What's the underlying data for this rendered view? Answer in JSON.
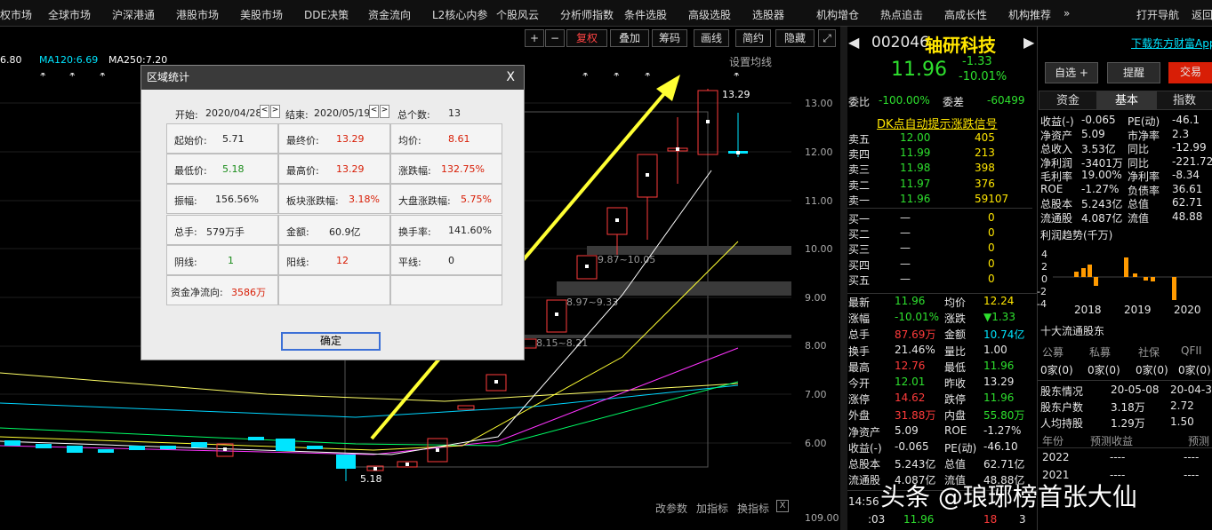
{
  "nav": [
    "权市场",
    "全球市场",
    "沪深港通",
    "港股市场",
    "美股市场",
    "DDE决策",
    "资金流向",
    "L2核心内参",
    "个股风云",
    "分析师指数",
    "条件选股",
    "高级选股",
    "选股器",
    "机构增仓",
    "热点追击",
    "高成长性",
    "机构推荐",
    "»",
    "打开导航",
    "返回"
  ],
  "toolbar": {
    "plus": "+",
    "minus": "−",
    "fuquan": "复权",
    "diejia": "叠加",
    "chouma": "筹码",
    "huaxian": "画线",
    "jianyue": "简约",
    "yincang": "隐藏"
  },
  "ma_labels": {
    "ma_a": "6.80",
    "ma120": "MA120:6.69",
    "ma250": "MA250:7.20",
    "setting": "设置均线"
  },
  "price_axis": [
    "13.00",
    "12.00",
    "11.00",
    "10.00",
    "9.00",
    "8.00",
    "7.00",
    "6.00",
    "109.00"
  ],
  "chart_annotations": {
    "high": "13.29",
    "low": "5.18",
    "gap1": "9.87~10.05",
    "gap2": "8.97~9.33",
    "gap3": "8.15~8.21"
  },
  "bottom_bar": {
    "gaicanshu": "改参数",
    "jiazhibiao": "加指标",
    "huanzhibiao": "换指标",
    "close": "X"
  },
  "dialog": {
    "title": "区域统计",
    "close": "X",
    "start_label": "开始:",
    "start": "2020/04/28",
    "end_label": "结束:",
    "end": "2020/05/19",
    "count_label": "总个数:",
    "count": "13",
    "qishi_label": "起始价:",
    "qishi": "5.71",
    "zuizhong_label": "最终价:",
    "zuizhong": "13.29",
    "junjia_label": "均价:",
    "junjia": "8.61",
    "zuidi_label": "最低价:",
    "zuidi": "5.18",
    "zuigao_label": "最高价:",
    "zuigao": "13.29",
    "zhangdie_label": "涨跌幅:",
    "zhangdie": "132.75%",
    "zhenfu_label": "振幅:",
    "zhenfu": "156.56%",
    "bankuai_label": "板块涨跌幅:",
    "bankuai": "3.18%",
    "dapan_label": "大盘涨跌幅:",
    "dapan": "5.75%",
    "zongshou_label": "总手:",
    "zongshou": "579万手",
    "jine_label": "金额:",
    "jine": "60.9亿",
    "huanshou_label": "换手率:",
    "huanshou": "141.60%",
    "yinxian_label": "阴线:",
    "yinxian": "1",
    "yangxian_label": "阳线:",
    "yangxian": "12",
    "pingxian_label": "平线:",
    "pingxian": "0",
    "zijin_label": "资金净流向:",
    "zijin": "3586万",
    "ok": "确定"
  },
  "stock": {
    "code": "002046",
    "name": "轴研科技",
    "price": "11.96",
    "change": "-1.33",
    "pct": "-10.01%",
    "download": "下载东方财富App",
    "zixuan": "自选 +",
    "tixing": "提醒",
    "jiaoyi": "交易"
  },
  "weibi": {
    "label1": "委比",
    "v1": "-100.00%",
    "label2": "委差",
    "v2": "-60499"
  },
  "signal": "DK点自动提示涨跌信号",
  "orders": [
    {
      "l": "卖五",
      "p": "12.00",
      "v": "405"
    },
    {
      "l": "卖四",
      "p": "11.99",
      "v": "213"
    },
    {
      "l": "卖三",
      "p": "11.98",
      "v": "398"
    },
    {
      "l": "卖二",
      "p": "11.97",
      "v": "376"
    },
    {
      "l": "卖一",
      "p": "11.96",
      "v": "59107"
    },
    {
      "l": "买一",
      "p": "—",
      "v": "0"
    },
    {
      "l": "买二",
      "p": "—",
      "v": "0"
    },
    {
      "l": "买三",
      "p": "—",
      "v": "0"
    },
    {
      "l": "买四",
      "p": "—",
      "v": "0"
    },
    {
      "l": "买五",
      "p": "—",
      "v": "0"
    }
  ],
  "quote": [
    {
      "k1": "最新",
      "v1": "11.96",
      "k2": "均价",
      "v2": "12.24"
    },
    {
      "k1": "涨幅",
      "v1": "-10.01%",
      "k2": "涨跌",
      "v2": "▼1.33"
    },
    {
      "k1": "总手",
      "v1": "87.69万",
      "k2": "金额",
      "v2": "10.74亿"
    },
    {
      "k1": "换手",
      "v1": "21.46%",
      "k2": "量比",
      "v2": "1.00"
    },
    {
      "k1": "最高",
      "v1": "12.76",
      "k2": "最低",
      "v2": "11.96"
    },
    {
      "k1": "今开",
      "v1": "12.01",
      "k2": "昨收",
      "v2": "13.29"
    },
    {
      "k1": "涨停",
      "v1": "14.62",
      "k2": "跌停",
      "v2": "11.96"
    },
    {
      "k1": "外盘",
      "v1": "31.88万",
      "k2": "内盘",
      "v2": "55.80万"
    },
    {
      "k1": "净资产",
      "v1": "5.09",
      "k2": "ROE",
      "v2": "-1.27%"
    },
    {
      "k1": "收益(-)",
      "v1": "-0.065",
      "k2": "PE(动)",
      "v2": "-46.10"
    },
    {
      "k1": "总股本",
      "v1": "5.243亿",
      "k2": "总值",
      "v2": "62.71亿"
    },
    {
      "k1": "流通股",
      "v1": "4.087亿",
      "k2": "流值",
      "v2": "48.88亿"
    }
  ],
  "tick": {
    "time": "14:56",
    "sec": ":03",
    "price": "11.96",
    "vol": "18",
    "n": "3"
  },
  "tabs": [
    "资金",
    "基本",
    "指数"
  ],
  "fund": [
    {
      "k1": "收益(-)",
      "v1": "-0.065",
      "k2": "PE(动)",
      "v2": "-46.1"
    },
    {
      "k1": "净资产",
      "v1": "5.09",
      "k2": "市净率",
      "v2": "2.3"
    },
    {
      "k1": "总收入",
      "v1": "3.53亿",
      "k2": "同比",
      "v2": "-12.99"
    },
    {
      "k1": "净利润",
      "v1": "-3401万",
      "k2": "同比",
      "v2": "-221.72"
    },
    {
      "k1": "毛利率",
      "v1": "19.00%",
      "k2": "净利率",
      "v2": "-8.34"
    },
    {
      "k1": "ROE",
      "v1": "-1.27%",
      "k2": "负债率",
      "v2": "36.61"
    },
    {
      "k1": "总股本",
      "v1": "5.243亿",
      "k2": "总值",
      "v2": "62.71"
    },
    {
      "k1": "流通股",
      "v1": "4.087亿",
      "k2": "流值",
      "v2": "48.88"
    }
  ],
  "profit_title": "利润趋势(千万)",
  "profit_axis": [
    "4",
    "2",
    "0",
    "-2",
    "-4"
  ],
  "profit_years": [
    "2018",
    "2019",
    "2020"
  ],
  "holders_title": "十大流通股东",
  "holder_types": [
    "公募",
    "私募",
    "社保",
    "QFII"
  ],
  "holder_counts": [
    "0家(0)",
    "0家(0)",
    "0家(0)",
    "0家(0)"
  ],
  "holder_rows": [
    {
      "k": "股东情况",
      "v1": "20-05-08",
      "v2": "20-04-3"
    },
    {
      "k": "股东户数",
      "v1": "3.18万",
      "v2": "2.72"
    },
    {
      "k": "人均持股",
      "v1": "1.29万",
      "v2": "1.50"
    }
  ],
  "forecast_head": [
    "年份",
    "预测收益",
    "预测"
  ],
  "forecast": [
    {
      "y": "2022",
      "a": "----",
      "b": "----"
    },
    {
      "y": "2021",
      "a": "----",
      "b": "----"
    }
  ],
  "watermark": "头条 @琅琊榜首张大仙"
}
